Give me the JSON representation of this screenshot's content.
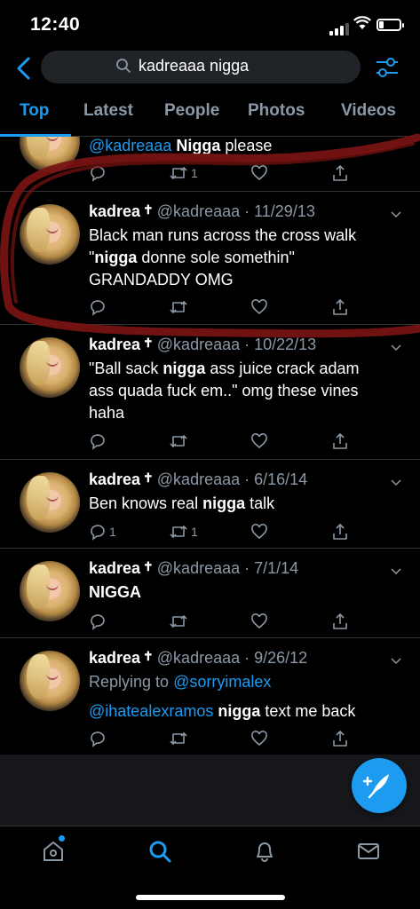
{
  "status": {
    "time": "12:40"
  },
  "search": {
    "query": "kadreaaa nigga"
  },
  "tabs": [
    {
      "label": "Top"
    },
    {
      "label": "Latest"
    },
    {
      "label": "People"
    },
    {
      "label": "Photos"
    },
    {
      "label": "Videos"
    }
  ],
  "colors": {
    "accent": "#1d9bf0",
    "muted": "#8b98a5",
    "annotation": "#7a1412"
  },
  "tweets": [
    {
      "handle_partial": "@kadreaaa",
      "word": "Nigga",
      "rest": "please",
      "retweets": "1"
    },
    {
      "name": "kadrea",
      "cross": "✝",
      "handle": "@kadreaaa · 11/29/13",
      "line1": "Black man runs across the cross walk",
      "line2_a": "\"",
      "line2_bold": "nigga",
      "line2_b": " donne sole somethin\"",
      "line3": "GRANDADDY OMG"
    },
    {
      "name": "kadrea",
      "cross": "✝",
      "handle": "@kadreaaa · 10/22/13",
      "line1_a": "\"Ball sack ",
      "line1_bold": "nigga",
      "line1_b": " ass juice crack adam",
      "line2": "ass quada fuck em..\" omg these vines",
      "line3": "haha"
    },
    {
      "name": "kadrea",
      "cross": "✝",
      "handle": "@kadreaaa · 6/16/14",
      "line1_a": "Ben knows real ",
      "line1_bold": "nigga",
      "line1_b": " talk",
      "replies": "1",
      "retweets": "1"
    },
    {
      "name": "kadrea",
      "cross": "✝",
      "handle": "@kadreaaa · 7/1/14",
      "line1_bold": "NIGGA"
    },
    {
      "name": "kadrea",
      "cross": "✝",
      "handle": "@kadreaaa · 9/26/12",
      "reply_prefix": "Replying to ",
      "reply_to": "@sorryimalex",
      "mention": "@ihatealexramos",
      "bold": "nigga",
      "rest": " text me back"
    }
  ],
  "icons": {
    "reply": "reply-icon",
    "retweet": "retweet-icon",
    "like": "heart-icon",
    "share": "share-icon",
    "home": "home-icon",
    "search": "search-icon",
    "notifications": "bell-icon",
    "messages": "mail-icon",
    "compose": "compose-icon"
  }
}
